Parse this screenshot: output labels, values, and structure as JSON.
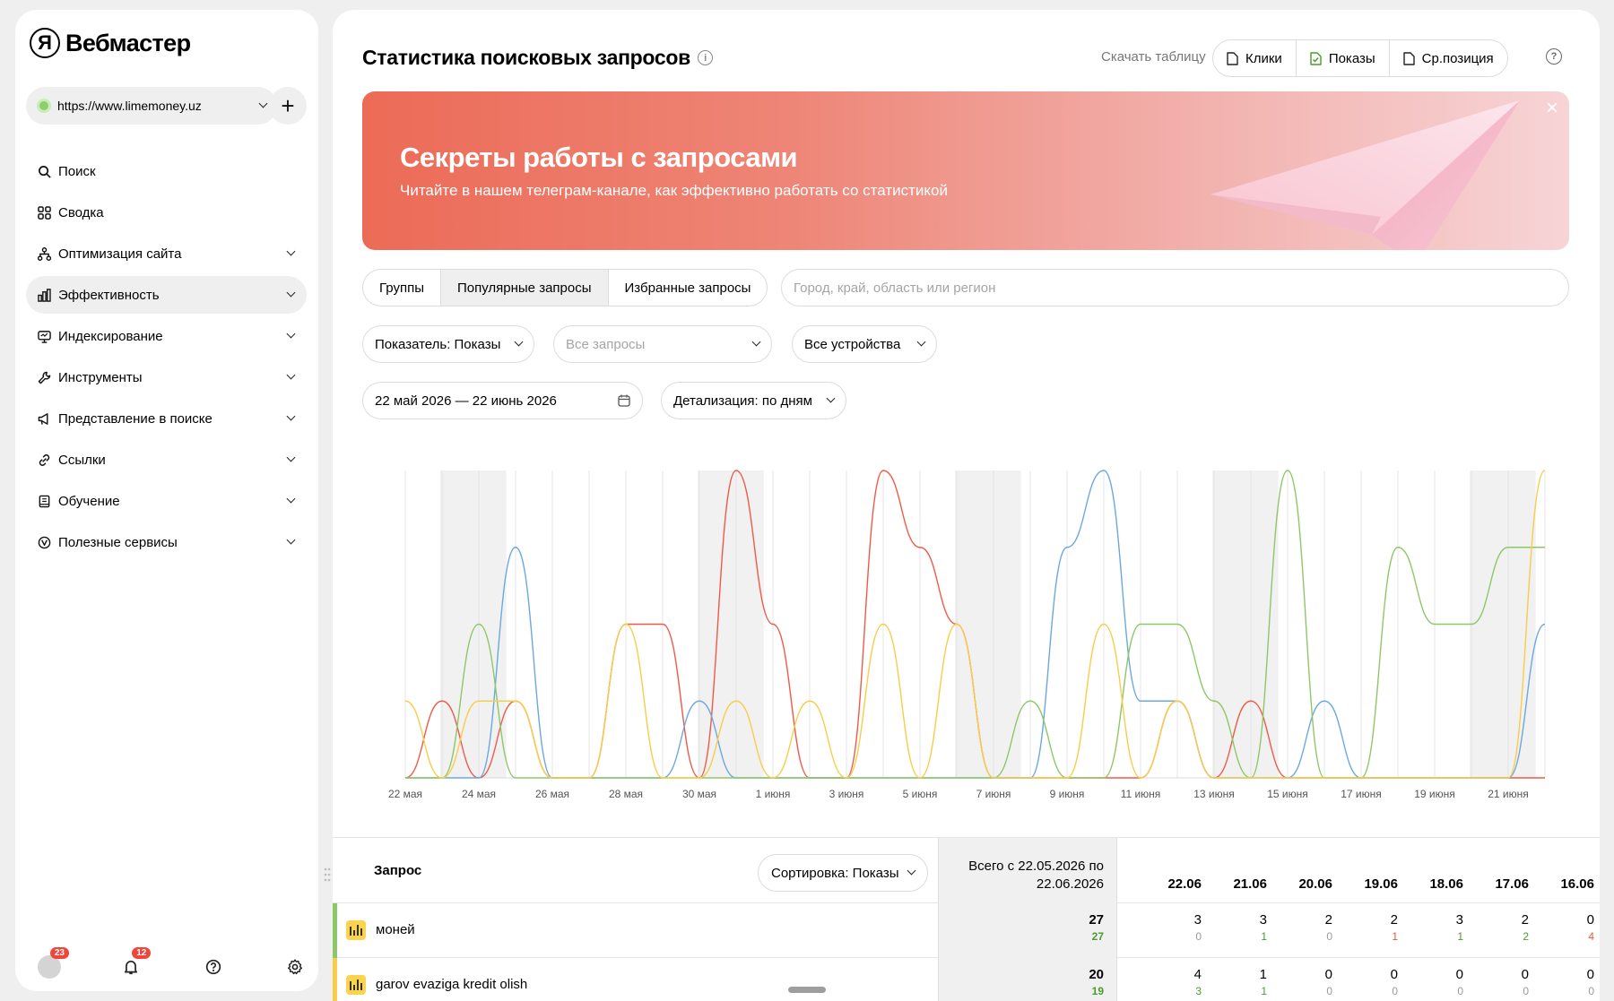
{
  "sidebar": {
    "logo_mark": "Я",
    "logo_text": "Вебмастер",
    "site_url": "https://www.limemoney.uz",
    "items": [
      {
        "label": "Поиск",
        "icon": "search-icon"
      },
      {
        "label": "Сводка",
        "icon": "grid-icon"
      },
      {
        "label": "Оптимизация сайта",
        "icon": "sitemap-icon"
      },
      {
        "label": "Эффективность",
        "icon": "bar-chart-icon"
      },
      {
        "label": "Индексирование",
        "icon": "monitor-icon"
      },
      {
        "label": "Инструменты",
        "icon": "wrench-icon"
      },
      {
        "label": "Представление в поиске",
        "icon": "megaphone-icon"
      },
      {
        "label": "Ссылки",
        "icon": "link-icon"
      },
      {
        "label": "Обучение",
        "icon": "book-icon"
      },
      {
        "label": "Полезные сервисы",
        "icon": "compass-icon"
      }
    ],
    "avatar_badge": "23",
    "notifications_badge": "12"
  },
  "header": {
    "title": "Статистика поисковых запросов",
    "download_label": "Скачать таблицу",
    "export_clicks": "Клики",
    "export_shows": "Показы",
    "export_position": "Ср.позиция"
  },
  "banner": {
    "title": "Секреты работы с запросами",
    "subtitle": "Читайте в нашем телеграм-канале, как эффективно работать со статистикой"
  },
  "tabs": [
    "Группы",
    "Популярные запросы",
    "Избранные запросы"
  ],
  "region": {
    "placeholder": "Город, край, область или регион"
  },
  "filters": {
    "metric": "Показатель: Показы",
    "queries_placeholder": "Все запросы",
    "devices": "Все устройства",
    "date_range": "22 май 2026 — 22 июнь 2026",
    "detail": "Детализация: по дням"
  },
  "chart_data": {
    "type": "line",
    "x": [
      "22 мая",
      "23 мая",
      "24 мая",
      "25 мая",
      "26 мая",
      "27 мая",
      "28 мая",
      "29 мая",
      "30 мая",
      "31 мая",
      "1 июня",
      "2 июня",
      "3 июня",
      "4 июня",
      "5 июня",
      "6 июня",
      "7 июня",
      "8 июня",
      "9 июня",
      "10 июня",
      "11 июня",
      "12 июня",
      "13 июня",
      "14 июня",
      "15 июня",
      "16 июня",
      "17 июня",
      "18 июня",
      "19 июня",
      "20 июня",
      "21 июня",
      "22 июня"
    ],
    "x_tick_labels": [
      "22 мая",
      "24 мая",
      "26 мая",
      "28 мая",
      "30 мая",
      "1 июня",
      "3 июня",
      "5 июня",
      "7 июня",
      "9 июня",
      "11 июня",
      "13 июня",
      "15 июня",
      "17 июня",
      "19 июня",
      "21 июня"
    ],
    "weekend_bands": [
      [
        1,
        2
      ],
      [
        8,
        9
      ],
      [
        15,
        16
      ],
      [
        22,
        23
      ],
      [
        29,
        30
      ]
    ],
    "ylim": [
      0,
      4
    ],
    "series": [
      {
        "color": "#ee5a48",
        "values": [
          0,
          1,
          0,
          1,
          0,
          0,
          2,
          2,
          0,
          4,
          2,
          0,
          0,
          4,
          3,
          2,
          0,
          0,
          0,
          0,
          0,
          1,
          0,
          1,
          0,
          0,
          0,
          0,
          0,
          0,
          0,
          0
        ]
      },
      {
        "color": "#6ba8e0",
        "values": [
          0,
          0,
          0,
          3,
          0,
          0,
          0,
          0,
          1,
          0,
          0,
          0,
          0,
          0,
          0,
          0,
          0,
          0,
          3,
          4,
          1,
          1,
          0,
          0,
          0,
          1,
          0,
          0,
          0,
          0,
          0,
          2
        ]
      },
      {
        "color": "#8ec768",
        "values": [
          0,
          0,
          2,
          0,
          0,
          0,
          0,
          0,
          0,
          0,
          0,
          0,
          0,
          0,
          0,
          0,
          0,
          1,
          0,
          0,
          2,
          2,
          1,
          0,
          4,
          0,
          0,
          3,
          2,
          2,
          3,
          3
        ]
      },
      {
        "color": "#f7cd4b",
        "values": [
          1,
          0,
          1,
          1,
          0,
          0,
          2,
          0,
          0,
          1,
          0,
          1,
          0,
          2,
          0,
          2,
          0,
          0,
          0,
          2,
          0,
          1,
          0,
          0,
          0,
          0,
          0,
          0,
          0,
          0,
          0,
          4
        ]
      }
    ]
  },
  "table": {
    "col_query": "Запрос",
    "sort_label": "Сортировка: Показы",
    "total_header_1": "Всего с 22.05.2026 по",
    "total_header_2": "22.06.2026",
    "dates": [
      "22.06",
      "21.06",
      "20.06",
      "19.06",
      "18.06",
      "17.06",
      "16.06"
    ],
    "rows": [
      {
        "query": "моней",
        "bar_color": "#8ec768",
        "total": "27",
        "total_sub": "27",
        "total_sub_tone": "green",
        "cells": [
          {
            "v": "3",
            "s": "0",
            "t": "grey"
          },
          {
            "v": "3",
            "s": "1",
            "t": "green"
          },
          {
            "v": "2",
            "s": "0",
            "t": "grey"
          },
          {
            "v": "2",
            "s": "1",
            "t": "red"
          },
          {
            "v": "3",
            "s": "1",
            "t": "green"
          },
          {
            "v": "2",
            "s": "2",
            "t": "green"
          },
          {
            "v": "0",
            "s": "4",
            "t": "red"
          }
        ]
      },
      {
        "query": "garov evaziga kredit olish",
        "bar_color": "#f7cd4b",
        "total": "20",
        "total_sub": "19",
        "total_sub_tone": "green",
        "cells": [
          {
            "v": "4",
            "s": "3",
            "t": "green"
          },
          {
            "v": "1",
            "s": "1",
            "t": "green"
          },
          {
            "v": "0",
            "s": "0",
            "t": "grey"
          },
          {
            "v": "0",
            "s": "0",
            "t": "grey"
          },
          {
            "v": "0",
            "s": "0",
            "t": "grey"
          },
          {
            "v": "0",
            "s": "0",
            "t": "grey"
          },
          {
            "v": "0",
            "s": "0",
            "t": "grey"
          }
        ]
      }
    ]
  }
}
